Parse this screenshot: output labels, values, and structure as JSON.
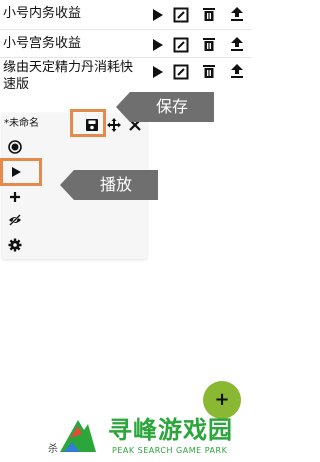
{
  "list": {
    "items": [
      {
        "label": "小号内务收益"
      },
      {
        "label": "小号宫务收益"
      },
      {
        "label": "缘由天定精力丹消耗快速版"
      }
    ]
  },
  "panel": {
    "title": "*未命名",
    "tools": [
      "record-icon",
      "play-icon",
      "plus-icon",
      "eye-off-icon",
      "gear-icon"
    ]
  },
  "callouts": {
    "save": "保存",
    "play": "播放"
  },
  "fab": {
    "label": "+"
  },
  "bottom_fragment": "杀",
  "watermark": {
    "title": "寻峰游戏园",
    "subtitle": "PEAK SEARCH GAME PARK"
  },
  "colors": {
    "highlight": "#e58a4a",
    "callout_bg": "#6f6f6f",
    "fab": "#8ab833",
    "watermark": "#2aa63a"
  }
}
